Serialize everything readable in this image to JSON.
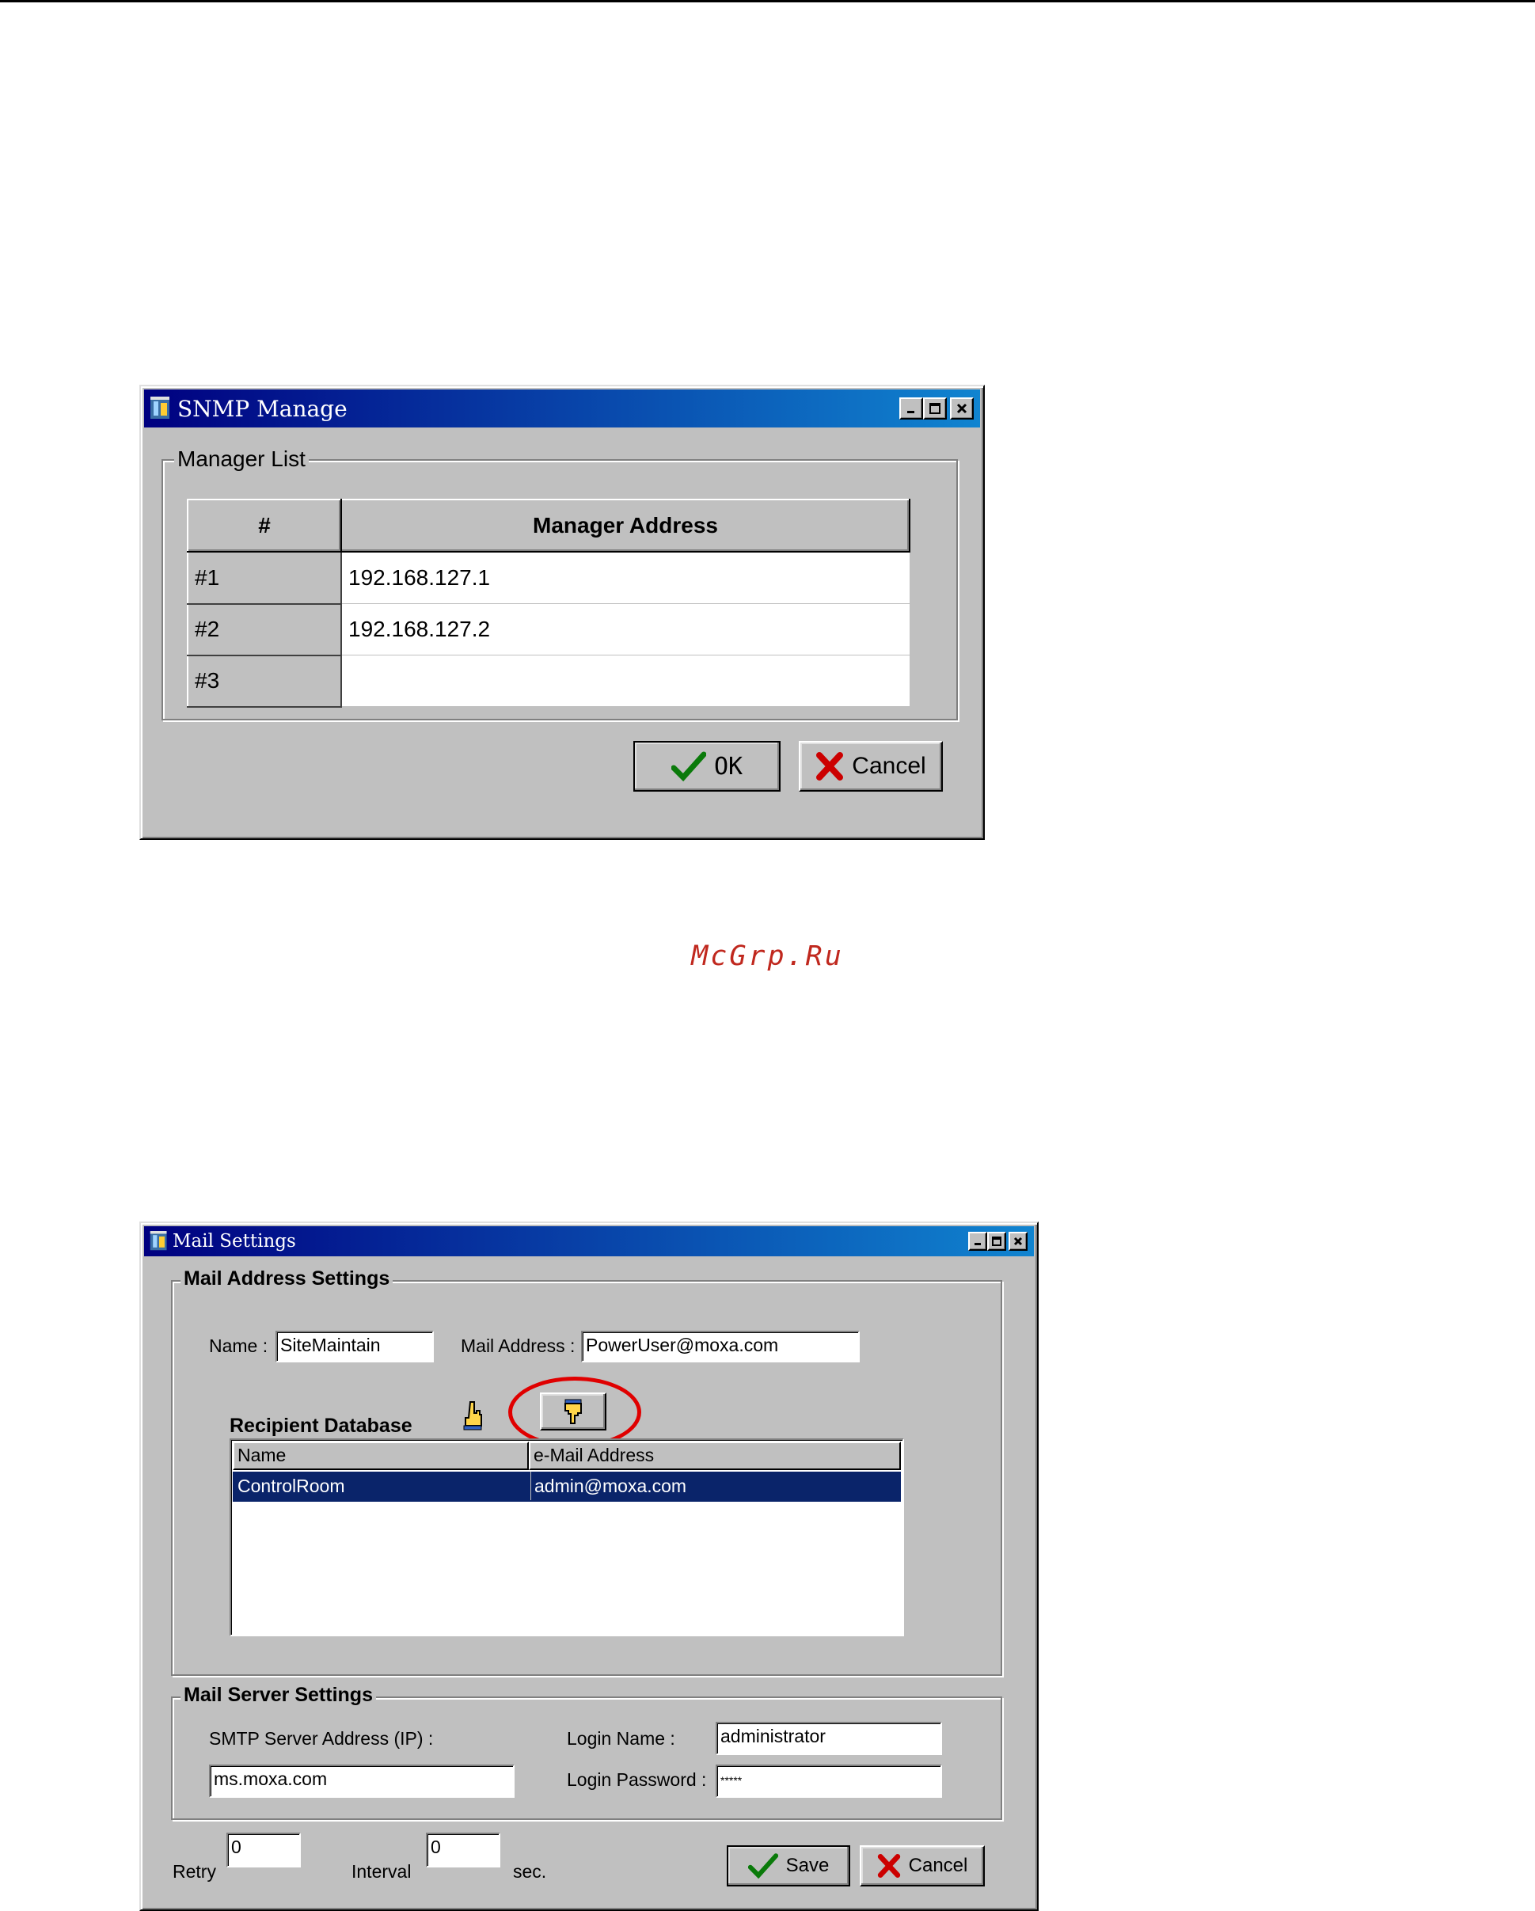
{
  "watermark": "McGrp.Ru",
  "snmp_window": {
    "title": "SNMP Manage",
    "group_title": "Manager List",
    "columns": [
      "#",
      "Manager Address"
    ],
    "rows": [
      {
        "index": "#1",
        "address": "192.168.127.1"
      },
      {
        "index": "#2",
        "address": "192.168.127.2"
      },
      {
        "index": "#3",
        "address": ""
      }
    ],
    "ok_label": "OK",
    "cancel_label": "Cancel"
  },
  "mail_window": {
    "title": "Mail Settings",
    "address_group_title": "Mail Address Settings",
    "name_label": "Name :",
    "name_value": "SiteMaintain",
    "mail_address_label": "Mail Address :",
    "mail_address_value": "PowerUser@moxa.com",
    "recipient_db_title": "Recipient Database",
    "recipient_columns": [
      "Name",
      "e-Mail Address"
    ],
    "recipients": [
      {
        "name": "ControlRoom",
        "email": "admin@moxa.com"
      }
    ],
    "server_group_title": "Mail Server Settings",
    "smtp_label": "SMTP Server Address (IP) :",
    "smtp_value": "ms.moxa.com",
    "login_name_label": "Login Name :",
    "login_name_value": "administrator",
    "login_password_label": "Login Password :",
    "login_password_value": "*****",
    "retry_label": "Retry",
    "retry_value": "0",
    "interval_label": "Interval",
    "interval_value": "0",
    "interval_unit": "sec.",
    "save_label": "Save",
    "cancel_label": "Cancel"
  },
  "colors": {
    "titlebar_start": "#000080",
    "titlebar_end": "#1084d0",
    "selection": "#0a246a",
    "highlight_circle": "#e00000",
    "ok_check": "#0a7a0a",
    "cancel_x": "#cc0000",
    "watermark": "#c0281e"
  },
  "icons": [
    "app-icon",
    "minimize-icon",
    "maximize-icon",
    "close-icon",
    "checkmark-icon",
    "x-icon",
    "hand-up-icon",
    "hand-down-icon"
  ]
}
